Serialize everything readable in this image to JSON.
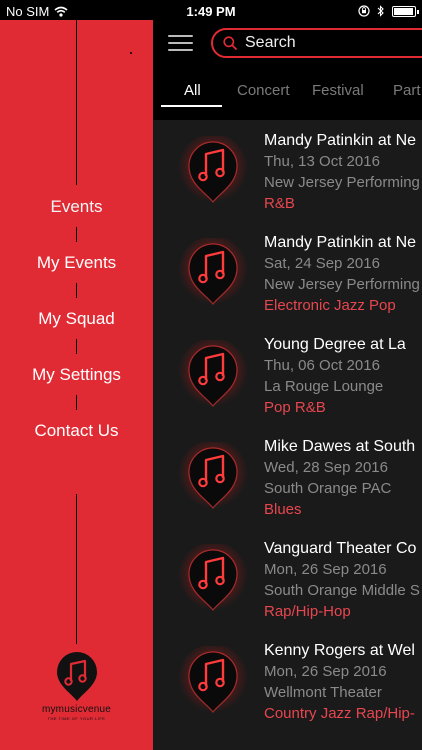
{
  "status_bar": {
    "carrier": "No SIM",
    "time": "1:49 PM",
    "battery_level": 0.95
  },
  "sidebar": {
    "items": [
      {
        "label": "Events"
      },
      {
        "label": "My Events"
      },
      {
        "label": "My Squad"
      },
      {
        "label": "My Settings"
      },
      {
        "label": "Contact Us"
      }
    ],
    "brand": {
      "name": "mymusicvenue",
      "tagline": "THE TIME OF YOUR LIFE"
    }
  },
  "search": {
    "placeholder": "Search"
  },
  "tabs": [
    "All",
    "Concert",
    "Festival",
    "Part"
  ],
  "colors": {
    "accent": "#e02b35",
    "genre": "#e8464f",
    "panel": "#1a1a1a"
  },
  "events": [
    {
      "title": "Mandy Patinkin at Ne",
      "date": "Thu, 13 Oct 2016",
      "venue": "New Jersey Performing",
      "genre": "R&B"
    },
    {
      "title": "Mandy Patinkin at Ne",
      "date": "Sat, 24 Sep 2016",
      "venue": "New Jersey Performing",
      "genre": "Electronic Jazz Pop"
    },
    {
      "title": "Young Degree at La",
      "date": "Thu, 06 Oct 2016",
      "venue": "La Rouge Lounge",
      "genre": "Pop R&B"
    },
    {
      "title": "Mike Dawes at South",
      "date": "Wed, 28 Sep 2016",
      "venue": "South Orange PAC",
      "genre": "Blues"
    },
    {
      "title": "Vanguard Theater Co",
      "date": "Mon, 26 Sep 2016",
      "venue": "South Orange Middle S",
      "genre": "Rap/Hip-Hop"
    },
    {
      "title": "Kenny Rogers at Wel",
      "date": "Mon, 26 Sep 2016",
      "venue": "Wellmont Theater",
      "genre": "Country Jazz Rap/Hip-"
    }
  ]
}
